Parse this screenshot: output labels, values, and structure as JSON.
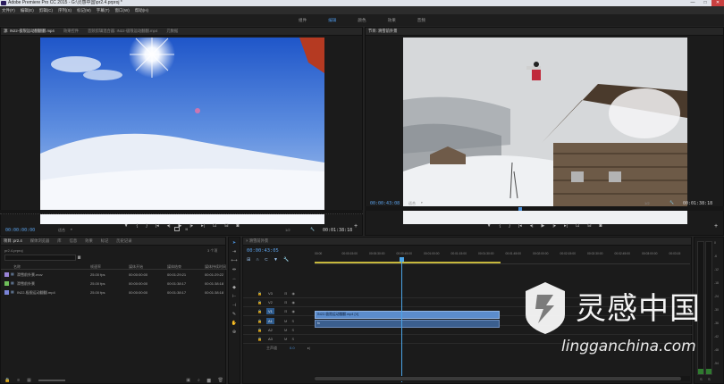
{
  "titlebar": {
    "title": "Adobe Premiere Pro CC 2015 - G:\\灵感中国\\pr2.4.prproj *"
  },
  "window_controls": {
    "minimize": "—",
    "maximize": "□",
    "close": "✕"
  },
  "menu": [
    "文件(F)",
    "编辑(E)",
    "剪辑(C)",
    "序列(S)",
    "标记(M)",
    "字幕(T)",
    "窗口(W)",
    "帮助(H)"
  ],
  "workspaces": {
    "items": [
      "组件",
      "编辑",
      "颜色",
      "效果",
      "音频"
    ],
    "active": "编辑"
  },
  "source_monitor": {
    "tabs": [
      "源: IN22-极限运动翻翻翻.mp4",
      "效果控件",
      "音频剪辑混合器: IN22-极限运动翻翻.mp4",
      "元数据"
    ],
    "timecode": "00:00:00:00",
    "fit": "适合",
    "scale": "1/2",
    "duration": "00:01:38:18"
  },
  "program_monitor": {
    "tab": "节目: 滑雪前外景",
    "timecode": "00:00:43:08",
    "fit": "适合",
    "scale": "1/2",
    "duration": "00:01:38:18"
  },
  "project_panel": {
    "tabs": [
      "项目: pr2.4",
      "媒体浏览器",
      "库",
      "信息",
      "效果",
      "标记",
      "历史记录"
    ],
    "project_file": "pr2.4.prproj",
    "item_count": "3 个项",
    "headers": [
      "名称",
      "帧速率",
      "媒体开始",
      "媒体结束",
      "媒体持续时间"
    ],
    "rows": [
      {
        "name": "滑雪前外景.mov",
        "fps": "25.00 fps",
        "start": "00:00:00:00",
        "end": "00:01:29:21",
        "dur": "00:01:29:22",
        "color": "#9a84d8"
      },
      {
        "name": "滑雪前外景",
        "fps": "25.00 fps",
        "start": "00:00:00:00",
        "end": "00:01:38:17",
        "dur": "00:01:38:18",
        "color": "#6fbf5a"
      },
      {
        "name": "IN22-极限运动翻翻.mp4",
        "fps": "25.00 fps",
        "start": "00:00:00:00",
        "end": "00:01:38:17",
        "dur": "00:01:38:18",
        "color": "#7a84d8"
      }
    ]
  },
  "timeline": {
    "tab": "滑雪前外景",
    "timecode": "00:00:43:05",
    "ruler": [
      "00:00",
      "00:00:15:00",
      "00:00:30:00",
      "00:00:45:00",
      "00:01:00:00",
      "00:01:15:00",
      "00:01:30:00",
      "00:01:45:00",
      "00:02:00:00",
      "00:02:15:00",
      "00:02:30:00",
      "00:02:45:00",
      "00:03:00:00",
      "00:03:15"
    ],
    "video_tracks": [
      "V3",
      "V2",
      "V1"
    ],
    "audio_tracks": [
      "A1",
      "A2",
      "A3"
    ],
    "master": "主声道",
    "master_value": "0.0",
    "clip_video_label": "IN22-极限运动翻翻.mp4 [V]",
    "playhead_fraction": 0.23
  },
  "meter_scale": [
    "0",
    "-6",
    "-12",
    "-18",
    "-24",
    "-30",
    "-36",
    "-42",
    "-48",
    "-54"
  ],
  "watermark": {
    "brand_cn": "灵感中国",
    "url": "lingganchina.com"
  },
  "colors": {
    "accent": "#4a8fd8",
    "clip_video": "#5b8ccc",
    "clip_audio": "#3b5f8f",
    "playhead": "#4aa3e6"
  }
}
